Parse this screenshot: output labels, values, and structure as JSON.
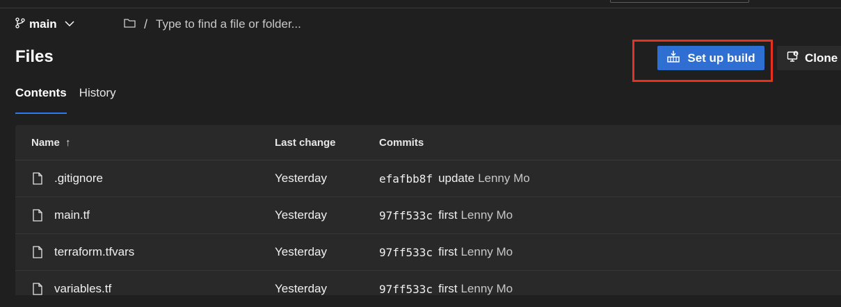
{
  "branch": {
    "name": "main"
  },
  "path": {
    "placeholder": "Type to find a file or folder...",
    "separator": "/"
  },
  "page": {
    "title": "Files"
  },
  "actions": {
    "setup_build_label": "Set up build",
    "clone_label": "Clone"
  },
  "tabs": [
    {
      "label": "Contents",
      "active": true
    },
    {
      "label": "History",
      "active": false
    }
  ],
  "table": {
    "headers": {
      "name": "Name",
      "sort_indicator": "↑",
      "last_change": "Last change",
      "commits": "Commits"
    },
    "rows": [
      {
        "name": ".gitignore",
        "last_change": "Yesterday",
        "hash": "efafbb8f",
        "message": "update",
        "author": "Lenny Mo"
      },
      {
        "name": "main.tf",
        "last_change": "Yesterday",
        "hash": "97ff533c",
        "message": "first",
        "author": "Lenny Mo"
      },
      {
        "name": "terraform.tfvars",
        "last_change": "Yesterday",
        "hash": "97ff533c",
        "message": "first",
        "author": "Lenny Mo"
      },
      {
        "name": "variables.tf",
        "last_change": "Yesterday",
        "hash": "97ff533c",
        "message": "first",
        "author": "Lenny Mo"
      }
    ]
  },
  "colors": {
    "accent": "#2f6ed3",
    "highlight": "#e8301f",
    "background": "#1f1f1f",
    "table_bg": "#292929"
  },
  "icons": {
    "branch": "branch-icon",
    "folder": "folder-icon",
    "file": "file-icon",
    "build": "build-icon",
    "clone": "clone-icon"
  }
}
